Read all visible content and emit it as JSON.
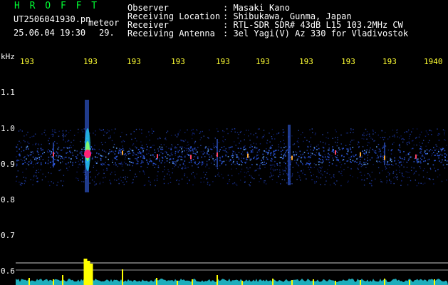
{
  "app": {
    "name": "H R O F F T",
    "filename": "UT2506041930.pn",
    "event_tag": "meteor",
    "datetime": "25.06.04 19:30",
    "frame_number": "29."
  },
  "info": {
    "rows": [
      {
        "label": "Observer",
        "value": ": Masaki Kano"
      },
      {
        "label": "Receiving Location",
        "value": ": Shibukawa, Gunma, Japan"
      },
      {
        "label": "Receiver",
        "value": ": RTL-SDR SDR# 43dB L15 103.2MHz CW"
      },
      {
        "label": "Receiving Antenna",
        "value": ": 3el Yagi(V) Az 330 for Vladivostok"
      }
    ]
  },
  "axis": {
    "y_unit": "kHz",
    "y_ticks": [
      "1.1",
      "1.0",
      "0.9",
      "0.8",
      "0.7",
      "0.6"
    ],
    "x_ticks": [
      "193",
      "193",
      "193",
      "193",
      "193",
      "193",
      "193",
      "193",
      "193",
      "1940"
    ]
  },
  "colors": {
    "background": "#000000",
    "text": "#ffffff",
    "title": "#00ff33",
    "ticks": "#ffff33",
    "signal_hot": "#ff2277",
    "trace": "#ffff00",
    "noise": "#22ccdd"
  }
}
